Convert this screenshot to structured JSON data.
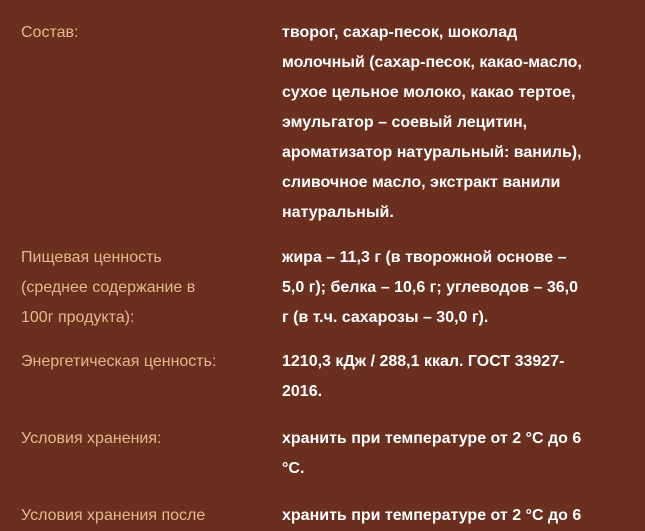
{
  "colors": {
    "background": "#6b2f20",
    "label_text": "#e2b98c",
    "value_text": "#ffffff"
  },
  "rows": [
    {
      "label": "Состав:",
      "value": "творог, сахар-песок, шоколад\nмолочный (сахар-песок, какао-масло,\nсухое цельное молоко, какао тертое,\nэмульгатор – соевый лецитин,\nароматизатор натуральный: ваниль),\nсливочное масло, экстракт ванили\nнатуральный."
    },
    {
      "label": "Пищевая ценность\n(среднее содержание в\n100г продукта):",
      "value": "жира – 11,3 г (в творожной основе –\n5,0 г); белка – 10,6 г; углеводов – 36,0\nг (в т.ч. сахарозы – 30,0 г)."
    },
    {
      "label": "Энергетическая ценность:",
      "value": "1210,3 кДж / 288,1 ккал. ГОСТ 33927-\n2016."
    },
    {
      "label": "Условия хранения:",
      "value": "хранить при температуре от 2 °С до 6\n°С."
    },
    {
      "label": "Условия хранения после",
      "value": "хранить при температуре от 2 °С до 6"
    }
  ]
}
